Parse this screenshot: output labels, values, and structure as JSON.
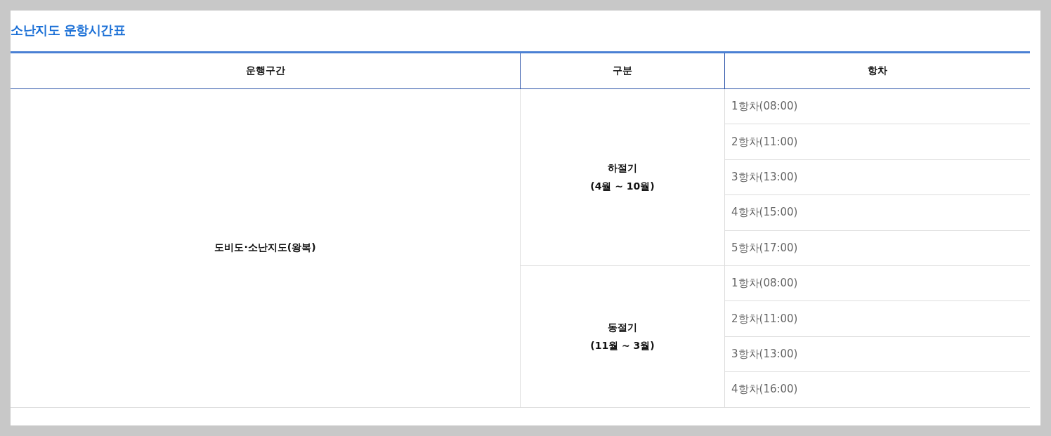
{
  "title": "소난지도 운항시간표",
  "table": {
    "columns": [
      "운행구간",
      "구분",
      "항차"
    ],
    "route": "도비도·소난지도(왕복)",
    "seasons": [
      {
        "name": "하절기",
        "period": "(4월 ~ 10월)",
        "voyages": [
          "1항차(08:00)",
          "2항차(11:00)",
          "3항차(13:00)",
          "4항차(15:00)",
          "5항차(17:00)"
        ]
      },
      {
        "name": "동절기",
        "period": "(11월 ~ 3월)",
        "voyages": [
          "1항차(08:00)",
          "2항차(11:00)",
          "3항차(13:00)",
          "4항차(16:00)"
        ]
      }
    ]
  }
}
